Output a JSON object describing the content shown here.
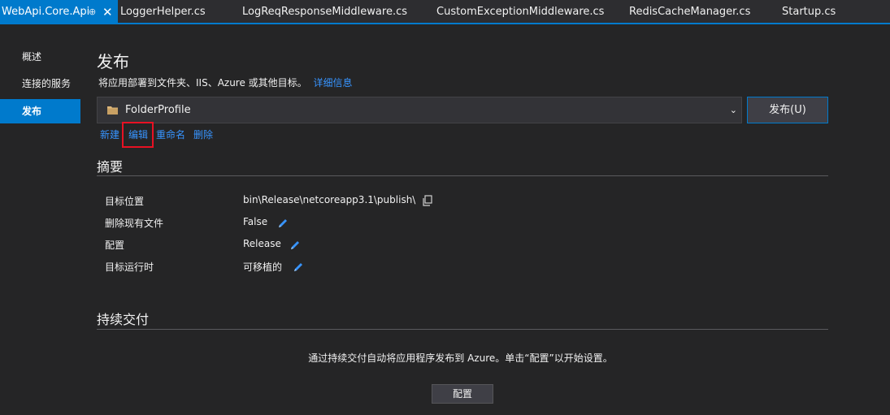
{
  "tabs": [
    {
      "label": "WebApi.Core.Api",
      "active": true
    },
    {
      "label": "LoggerHelper.cs",
      "active": false
    },
    {
      "label": "LogReqResponseMiddleware.cs",
      "active": false
    },
    {
      "label": "CustomExceptionMiddleware.cs",
      "active": false
    },
    {
      "label": "RedisCacheManager.cs",
      "active": false
    },
    {
      "label": "Startup.cs",
      "active": false
    }
  ],
  "tab_pin_glyph": "⊕",
  "tab_close_glyph": "✕",
  "nav": {
    "items": [
      {
        "label": "概述"
      },
      {
        "label": "连接的服务"
      },
      {
        "label": "发布",
        "selected": true
      }
    ]
  },
  "main": {
    "title": "发布",
    "description": "将应用部署到文件夹、IIS、Azure 或其他目标。",
    "details_link": "详细信息",
    "profile": {
      "value": "FolderProfile",
      "icon": "folder-icon",
      "dropdown_glyph": "⌄"
    },
    "publish_button": "发布(U)",
    "actions": {
      "new": "新建",
      "edit": "编辑",
      "rename": "重命名",
      "delete": "删除"
    }
  },
  "summary": {
    "title": "摘要",
    "rows": [
      {
        "label": "目标位置",
        "value": "bin\\Release\\netcoreapp3.1\\publish\\",
        "icon": "copy-icon"
      },
      {
        "label": "删除现有文件",
        "value": "False",
        "icon": "edit-pencil-icon"
      },
      {
        "label": "配置",
        "value": "Release",
        "icon": "edit-pencil-icon"
      },
      {
        "label": "目标运行时",
        "value": "可移植的",
        "icon": "edit-pencil-icon"
      }
    ]
  },
  "continuous_delivery": {
    "title": "持续交付",
    "description": "通过持续交付自动将应用程序发布到 Azure。单击“配置”以开始设置。",
    "configure_button": "配置"
  },
  "colors": {
    "accent": "#007acc",
    "link": "#3794ff",
    "highlight": "#e81123",
    "background": "#252526"
  }
}
